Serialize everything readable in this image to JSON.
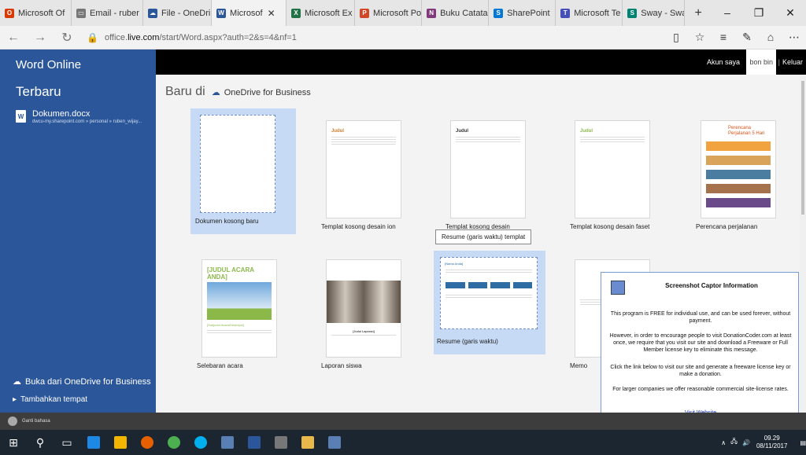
{
  "browser": {
    "tabs": [
      {
        "label": "Microsoft Of",
        "color": "#d83b01",
        "glyph": "O"
      },
      {
        "label": "Email - ruber",
        "color": "#666666",
        "glyph": "▭"
      },
      {
        "label": "File - OneDri",
        "color": "#2b579a",
        "glyph": "☁"
      },
      {
        "label": "Microsof",
        "color": "#2b579a",
        "glyph": "W",
        "active": true
      },
      {
        "label": "Microsoft Ex",
        "color": "#217346",
        "glyph": "X"
      },
      {
        "label": "Microsoft Po",
        "color": "#d24726",
        "glyph": "P"
      },
      {
        "label": "Buku Catatai",
        "color": "#80397b",
        "glyph": "N"
      },
      {
        "label": "SharePoint",
        "color": "#0078d4",
        "glyph": "S"
      },
      {
        "label": "Microsoft Te",
        "color": "#464eb8",
        "glyph": "T"
      },
      {
        "label": "Sway - Sway",
        "color": "#008272",
        "glyph": "S"
      }
    ],
    "new_tab": "+",
    "address_prefix": "office.",
    "address_domain": "live.com",
    "address_rest": "/start/Word.aspx?auth=2&s=4&nf=1"
  },
  "sidebar": {
    "app_title": "Word Online",
    "recent_heading": "Terbaru",
    "doc_name": "Dokumen.docx",
    "doc_path": "dwcu-my.sharepoint.com » personal » ruben_wijay...",
    "open_label": "Buka dari OneDrive for Business",
    "add_place_label": "Tambahkan tempat"
  },
  "header": {
    "account_label": "Akun saya",
    "user_name": "bon bin",
    "separator": "|",
    "logout_label": "Keluar"
  },
  "main": {
    "heading": "Baru di",
    "location": "OneDrive for Business",
    "tooltip": "Resume (garis waktu) templat",
    "templates": [
      {
        "label": "Dokumen kosong baru"
      },
      {
        "label": "Templat kosong desain ion"
      },
      {
        "label": "Templat kosong desain"
      },
      {
        "label": "Templat kosong desain faset"
      },
      {
        "label": "Perencana perjalanan"
      },
      {
        "label": "Selebaran acara"
      },
      {
        "label": "Laporan siswa"
      },
      {
        "label": "Resume (garis waktu)"
      },
      {
        "label": "Memo"
      }
    ],
    "thumb_text": {
      "judul": "Judul",
      "judul_acara": "[JUDUL ACARA ANDA]",
      "subjudul_acara": "[Subjudul Acara/Deskripsi]",
      "judul_laporan": "[Judul Laporan]",
      "nama_anda": "[Nama Anda]",
      "perencana": "Perencana Perjalanan 5 Hari",
      "hari": "Hari"
    }
  },
  "popup": {
    "title": "Screenshot Captor Information",
    "p1": "This program is FREE for individual use, and can be used forever, without payment.",
    "p2": "However, in order to encourage people to visit DonationCoder.com at least once, we require that you visit our site and download a Freeware or Full Member license key to eliminate this message.",
    "p3": "Click the link below to visit our site and generate a freeware license key or make a donation.",
    "p4": "For larger companies we offer reasonable commercial site-license rates.",
    "link": "Visit Website"
  },
  "statusbar": {
    "language": "Ganti bahasa"
  },
  "taskbar": {
    "time": "09.29",
    "date": "08/11/2017"
  }
}
